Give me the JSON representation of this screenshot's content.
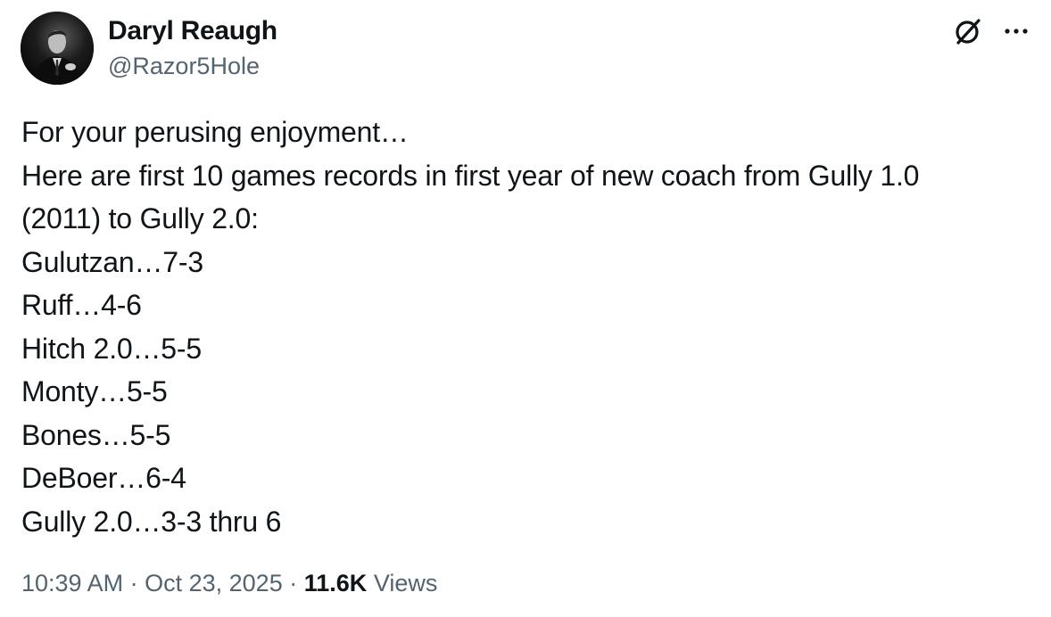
{
  "author": {
    "display_name": "Daryl Reaugh",
    "handle": "@Razor5Hole"
  },
  "icons": {
    "grok": "grok-icon",
    "more": "more-icon"
  },
  "post": {
    "lines": [
      "For your perusing enjoyment…",
      "Here are first 10 games records in first year of new coach from Gully 1.0",
      "(2011) to Gully 2.0:",
      "Gulutzan…7-3",
      "Ruff…4-6",
      "Hitch 2.0…5-5",
      "Monty…5-5",
      "Bones…5-5",
      "DeBoer…6-4",
      "Gully 2.0…3-3 thru 6"
    ]
  },
  "meta": {
    "time": "10:39 AM",
    "separator": "·",
    "date": "Oct 23, 2025",
    "views_count": "11.6K",
    "views_label": "Views"
  },
  "colors": {
    "text": "#0f1419",
    "secondary": "#536471"
  }
}
